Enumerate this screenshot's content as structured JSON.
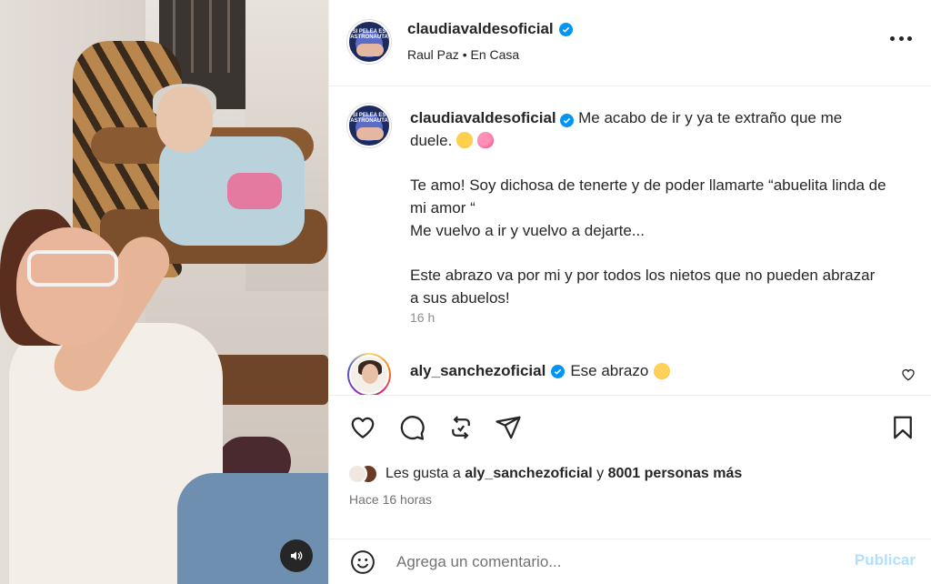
{
  "post": {
    "username": "claudiavaldesoficial",
    "verified": true,
    "location_name": "Raul Paz",
    "location_separator": "•",
    "location_place": "En Casa",
    "avatar_text": "SI PELEA ES ASTRONAUTA"
  },
  "caption": {
    "username": "claudiavaldesoficial",
    "line1": "Me acabo de ir y ya te extraño que me duele.",
    "emoji1": "pensive-face",
    "emoji2": "growing-heart",
    "line2": "Te amo! Soy dichosa de tenerte y de poder llamarte “abuelita linda de mi amor “",
    "line3": "Me vuelvo a ir y vuelvo a dejarte...",
    "line4": "Este abrazo va por mi y por todos los nietos que no pueden abrazar a sus abuelos!",
    "time": "16 h"
  },
  "comment": {
    "username": "aly_sanchezoficial",
    "verified": true,
    "text": "Ese abrazo",
    "emoji": "flushed-face"
  },
  "likes": {
    "prefix": "Les gusta a",
    "user": "aly_sanchezoficial",
    "connector": "y",
    "others": "8001 personas más"
  },
  "timestamp": "Hace 16 horas",
  "add_comment": {
    "placeholder": "Agrega un comentario...",
    "publish_label": "Publicar"
  },
  "icons": {
    "like": "heart-icon",
    "comment": "comment-icon",
    "share": "repost-icon",
    "send": "send-icon",
    "save": "bookmark-icon",
    "more": "more-icon",
    "sound": "volume-icon",
    "emoji": "smiley-icon"
  },
  "colors": {
    "verified": "#0095f6",
    "publish_disabled": "#b2dffc",
    "secondary_text": "#737373"
  }
}
